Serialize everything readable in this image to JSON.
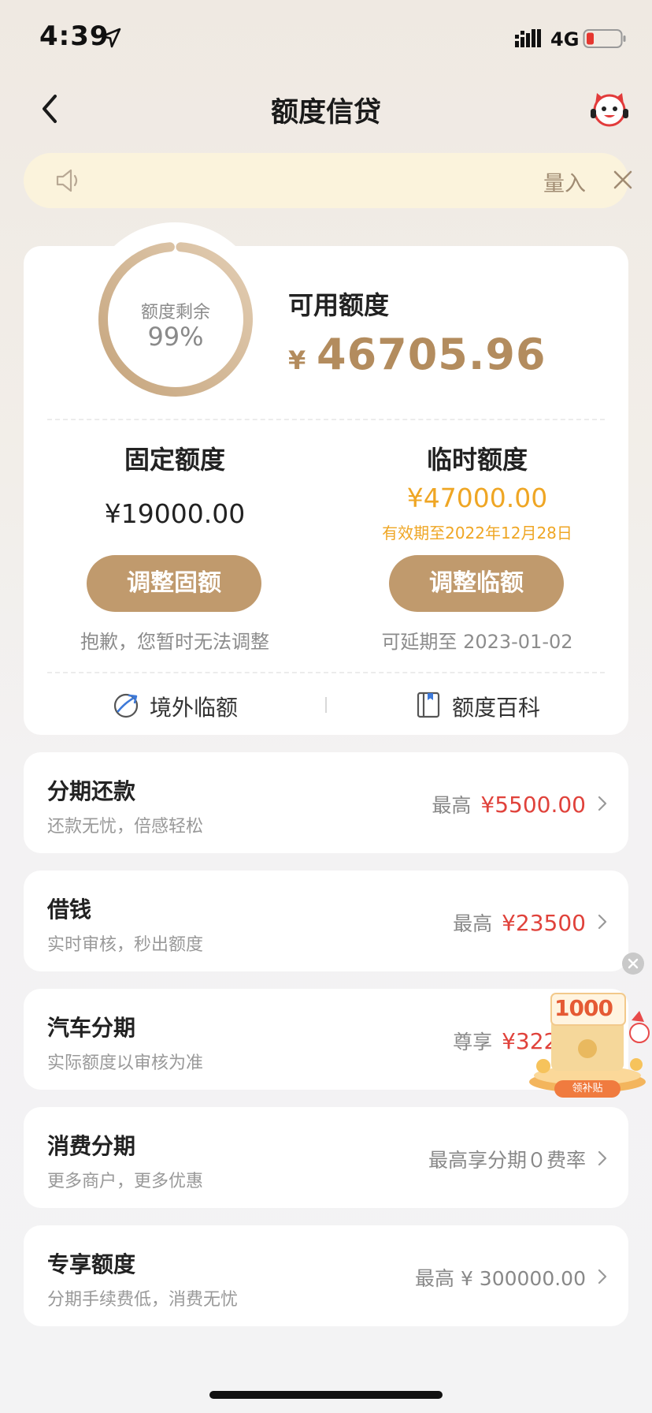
{
  "status_bar": {
    "time": "4:39",
    "network": "4G"
  },
  "nav": {
    "title": "额度信贷"
  },
  "notice": {
    "text": "量入"
  },
  "credit": {
    "ring_label": "额度剩余",
    "ring_percent": "99%",
    "ring_fraction": 0.99,
    "available_title": "可用额度",
    "currency_symbol": "¥",
    "available_amount": "46705.96",
    "fixed": {
      "title": "固定额度",
      "amount": "¥19000.00",
      "button": "调整固额",
      "hint": "抱歉，您暂时无法调整"
    },
    "temporary": {
      "title": "临时额度",
      "amount": "¥47000.00",
      "valid_until": "有效期至2022年12月28日",
      "button": "调整临额",
      "hint": "可延期至 2023-01-02"
    },
    "links": [
      {
        "label": "境外临额",
        "icon": "plane-globe-icon"
      },
      {
        "label": "额度百科",
        "icon": "book-icon"
      }
    ]
  },
  "services": [
    {
      "title": "分期还款",
      "subtitle": "还款无忧，倍感轻松",
      "prefix": "最高",
      "value": "¥5500.00"
    },
    {
      "title": "借钱",
      "subtitle": "实时审核，秒出额度",
      "prefix": "最高",
      "value": "¥23500"
    },
    {
      "title": "汽车分期",
      "subtitle": "实际额度以审核为准",
      "prefix": "尊享",
      "value": "¥32200"
    },
    {
      "title": "消费分期",
      "subtitle": "更多商户，更多优惠",
      "prefix": "最高享分期０费率",
      "value": ""
    },
    {
      "title": "专享额度",
      "subtitle": "分期手续费低，消费无忧",
      "prefix": "最高 ¥ 300000.00",
      "value": ""
    }
  ],
  "promo": {
    "amount": "1000",
    "tag": "领补贴"
  },
  "colors": {
    "gold": "#b38c5e",
    "button": "#c09a6d",
    "orange": "#efa624",
    "red": "#e0423b",
    "notice_bg": "#fbf3dc"
  }
}
